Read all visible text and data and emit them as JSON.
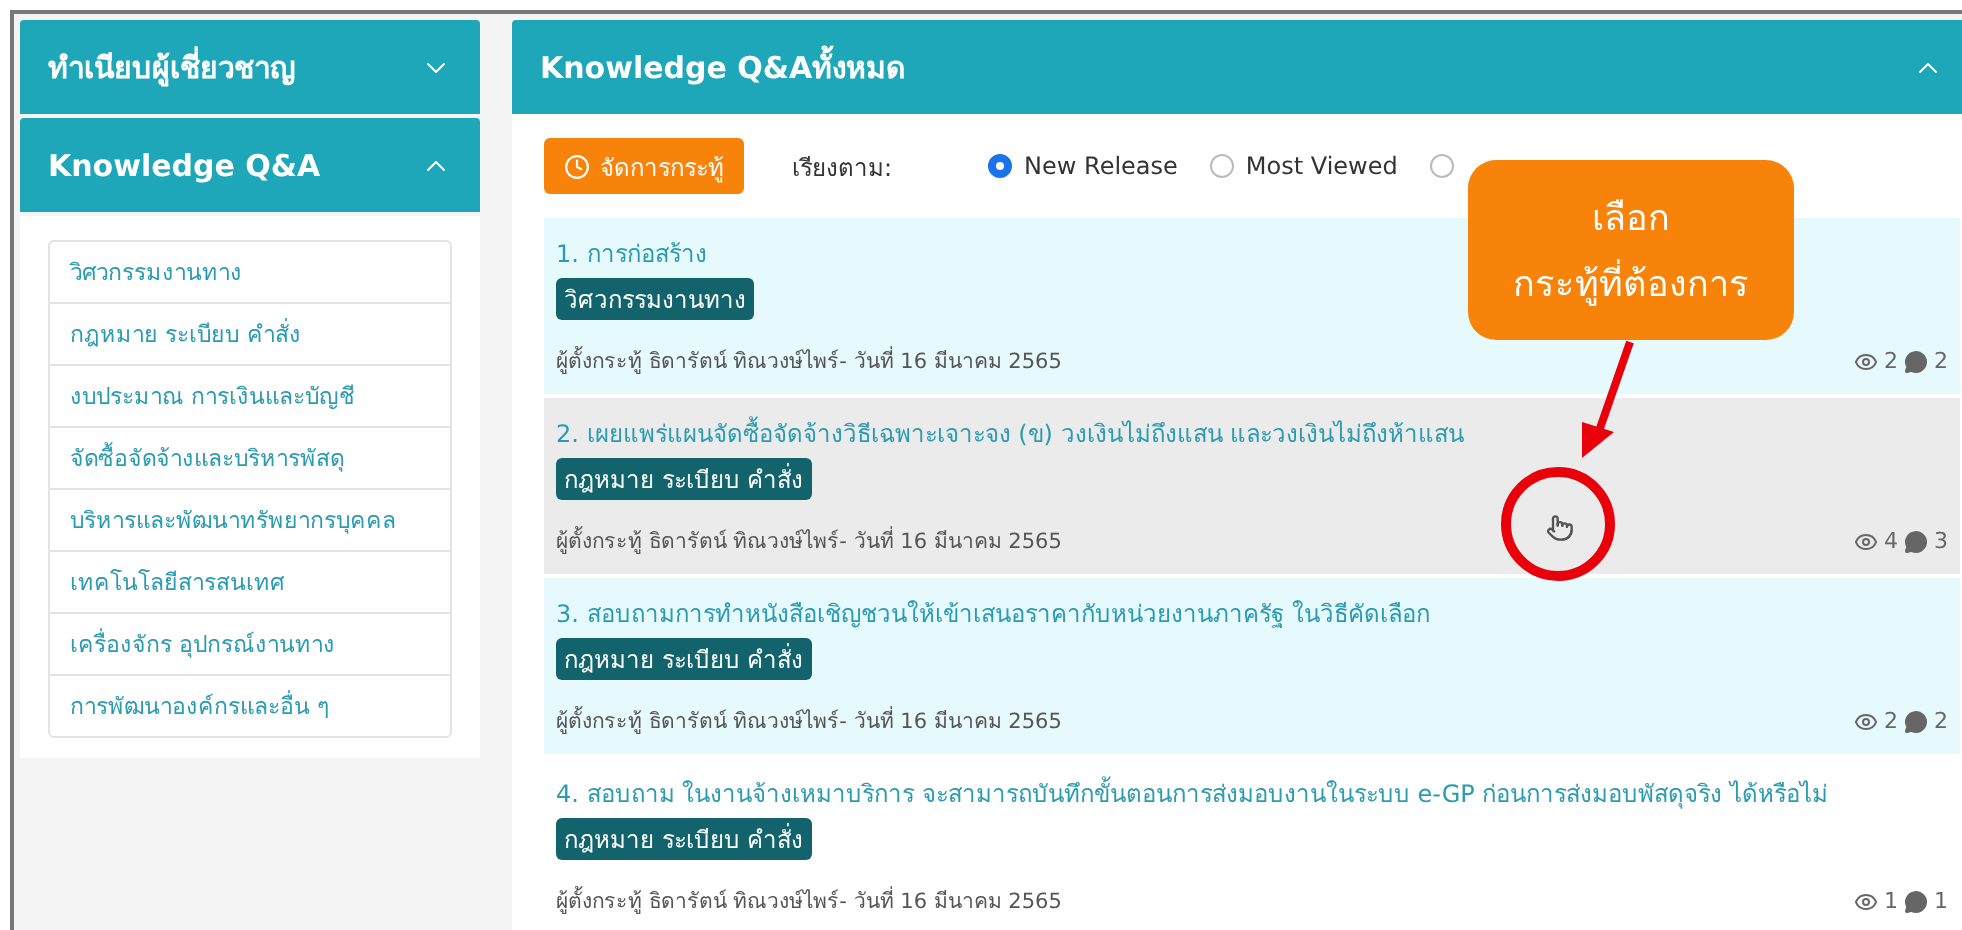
{
  "sidebar": {
    "sections": [
      {
        "title": "ทำเนียบผู้เชี่ยวชาญ",
        "expanded": false
      },
      {
        "title": "Knowledge Q&A",
        "expanded": true,
        "items": [
          "วิศวกรรมงานทาง",
          "กฎหมาย ระเบียบ คำสั่ง",
          "งบประมาณ การเงินและบัญชี",
          "จัดซื้อจัดจ้างและบริหารพัสดุ",
          "บริหารและพัฒนาทรัพยากรบุคคล",
          "เทคโนโลยีสารสนเทศ",
          "เครื่องจักร อุปกรณ์งานทาง",
          "การพัฒนาองค์กรและอื่น ๆ"
        ]
      }
    ]
  },
  "panel": {
    "title": "Knowledge Q&Aทั้งหมด",
    "expanded": true,
    "manage_button": "จัดการกระทู้",
    "sort_label": "เรียงตาม:",
    "sort_options": [
      {
        "label": "New Release",
        "selected": true
      },
      {
        "label": "Most Viewed",
        "selected": false
      },
      {
        "selected": false
      }
    ],
    "posts": [
      {
        "title": "1. การก่อสร้าง",
        "tag": "วิศวกรรมงานทาง",
        "meta": "ผู้ตั้งกระทู้ ธิดารัตน์ ทิณวงษ์ไพร์- วันที่ 16 มีนาคม 2565",
        "views": "2",
        "comments": "2",
        "color": "#e6f9fc"
      },
      {
        "title": "2. เผยแพร่แผนจัดซื้อจัดจ้างวิธีเฉพาะเจาะจง (ข) วงเงินไม่ถึงแสน และวงเงินไม่ถึงห้าแสน",
        "tag": "กฎหมาย ระเบียบ คำสั่ง",
        "meta": "ผู้ตั้งกระทู้ ธิดารัตน์ ทิณวงษ์ไพร์- วันที่ 16 มีนาคม 2565",
        "views": "4",
        "comments": "3",
        "color": "#ebebeb"
      },
      {
        "title": "3. สอบถามการทำหนังสือเชิญชวนให้เข้าเสนอราคากับหน่วยงานภาครัฐ ในวิธีคัดเลือก",
        "tag": "กฎหมาย ระเบียบ คำสั่ง",
        "meta": "ผู้ตั้งกระทู้ ธิดารัตน์ ทิณวงษ์ไพร์- วันที่ 16 มีนาคม 2565",
        "views": "2",
        "comments": "2",
        "color": "#e6f9fc"
      },
      {
        "title": "4. สอบถาม ในงานจ้างเหมาบริการ จะสามารถบันทึกขั้นตอนการส่งมอบงานในระบบ e-GP ก่อนการส่งมอบพัสดุจริง ได้หรือไม่",
        "tag": "กฎหมาย ระเบียบ คำสั่ง",
        "meta": "ผู้ตั้งกระทู้ ธิดารัตน์ ทิณวงษ์ไพร์- วันที่ 16 มีนาคม 2565",
        "views": "1",
        "comments": "1",
        "color": "#ffffff"
      }
    ]
  },
  "callout": {
    "lines": [
      "เลือก",
      "กระทู้ที่ต้องการ"
    ]
  }
}
